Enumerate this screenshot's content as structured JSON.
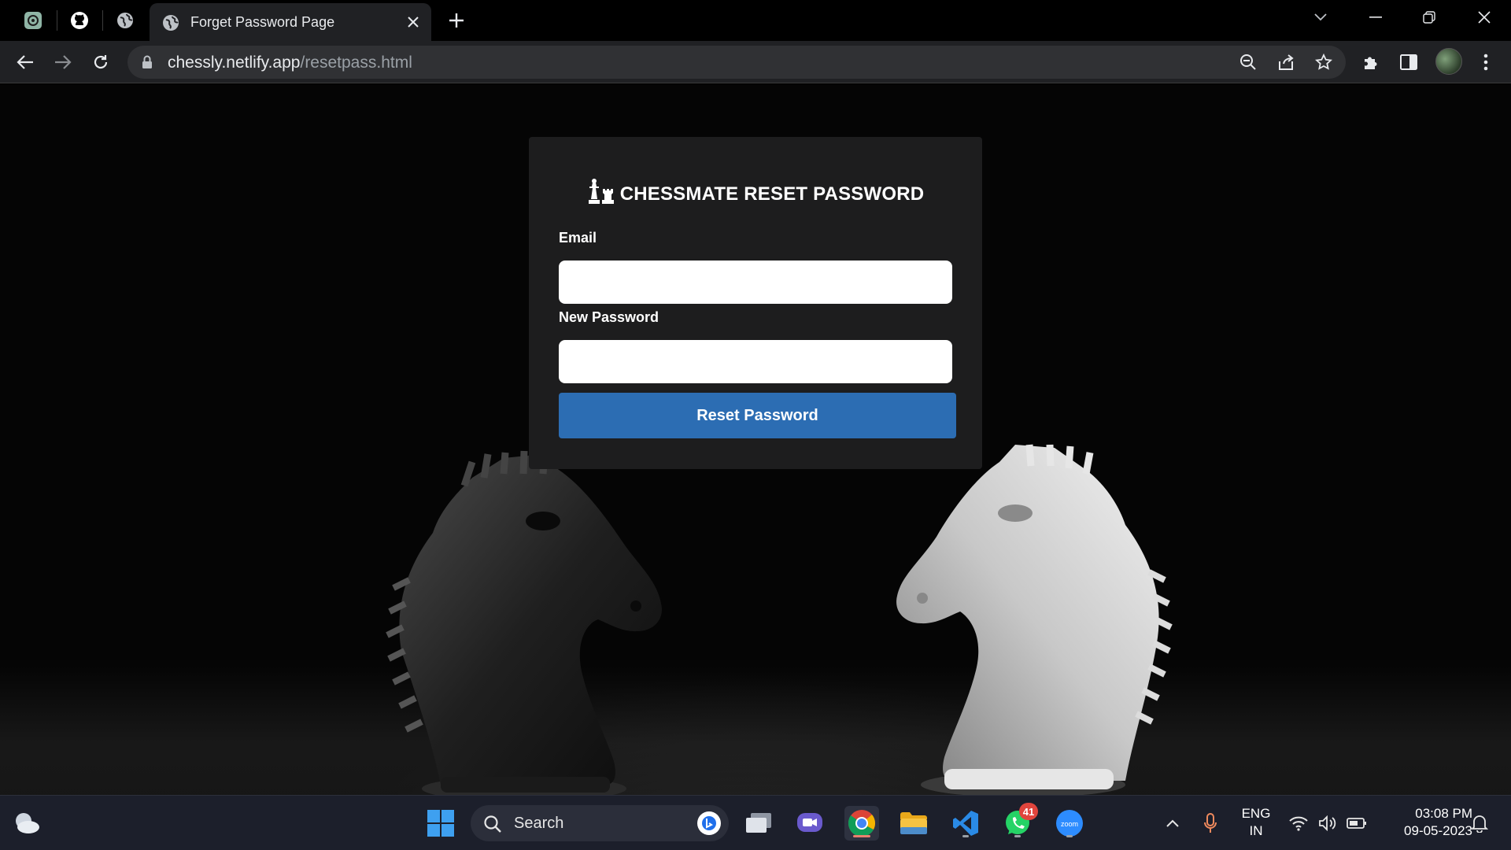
{
  "browser": {
    "tab_title": "Forget Password Page",
    "url_host": "chessly.netlify.app",
    "url_path": "/resetpass.html"
  },
  "card": {
    "title": "CHESSMATE RESET PASSWORD",
    "email_label": "Email",
    "email_value": "",
    "password_label": "New Password",
    "password_value": "",
    "submit_label": "Reset Password"
  },
  "taskbar": {
    "search_label": "Search",
    "whatsapp_badge": "41",
    "language_line1": "ENG",
    "language_line2": "IN",
    "time": "03:08 PM",
    "date": "09-05-2023"
  },
  "colors": {
    "accent_button": "#2c6db3",
    "card_bg": "#1d1d1e",
    "toolbar_bg": "#202124"
  }
}
